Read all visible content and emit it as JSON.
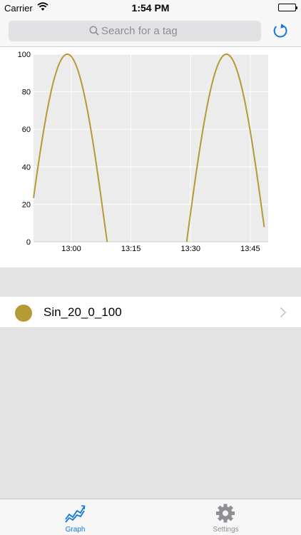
{
  "status_bar": {
    "carrier": "Carrier",
    "time": "1:54 PM"
  },
  "search": {
    "placeholder": "Search for a tag"
  },
  "chart_data": {
    "type": "line",
    "x_ticks": [
      "13:00",
      "13:15",
      "13:30",
      "13:45"
    ],
    "y_ticks": [
      "0",
      "20",
      "40",
      "60",
      "80",
      "100"
    ],
    "ylim": [
      0,
      100
    ],
    "xlim_minutes": [
      -9.5,
      49.5
    ],
    "grid": true,
    "series": [
      {
        "name": "Sin_20_0_100",
        "color": "#b59a35",
        "function": "100*sin(2*pi*(t+11)/40)",
        "description_x_units": "minutes after 13:00"
      }
    ]
  },
  "tags": [
    {
      "name": "Sin_20_0_100",
      "color": "#b59a35"
    }
  ],
  "tab_bar": {
    "graph_label": "Graph",
    "settings_label": "Settings",
    "active_color": "#1478d8",
    "inactive_color": "#8e8e93"
  }
}
